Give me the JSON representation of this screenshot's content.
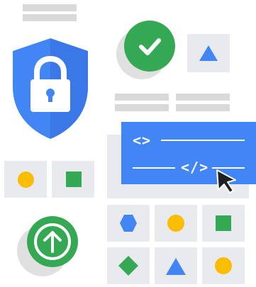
{
  "code_card": {
    "tag_open": "<>",
    "tag_close": "</>"
  },
  "colors": {
    "blue": "#4285f4",
    "green": "#34a853",
    "yellow": "#fbbc04",
    "gray": "#e8eaed",
    "bar_gray": "#d9d9d9"
  },
  "icons": {
    "shield": "shield-lock-icon",
    "check": "check-circle-icon",
    "upload": "upload-arrow-icon",
    "cursor": "mouse-cursor-icon",
    "code": "code-brackets-icon"
  }
}
